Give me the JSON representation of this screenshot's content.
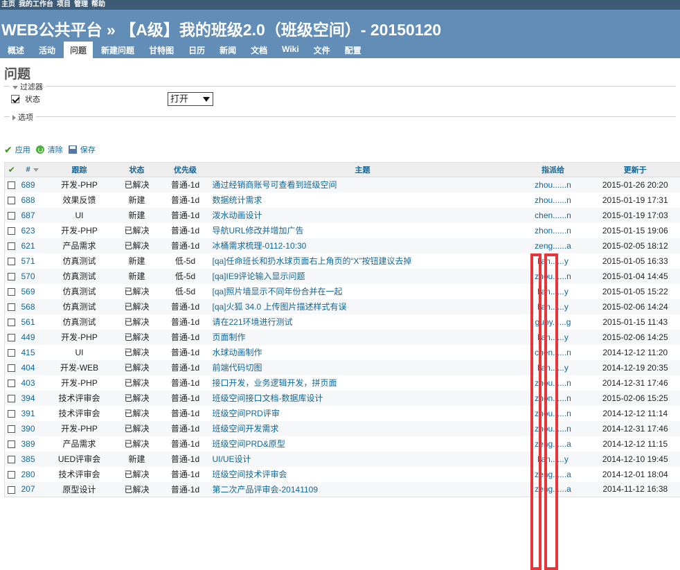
{
  "top_menu": [
    "主页",
    "我的工作台",
    "项目",
    "管理",
    "帮助"
  ],
  "header": {
    "title": "WEB公共平台 » 【A级】我的班级2.0（班级空间）- 20150120"
  },
  "tabs": [
    "概述",
    "活动",
    "问题",
    "新建问题",
    "甘特图",
    "日历",
    "新闻",
    "文档",
    "Wiki",
    "文件",
    "配置"
  ],
  "selected_tab": "问题",
  "page_title": "问题",
  "filters": {
    "legend": "过滤器",
    "status_label": "状态",
    "status_checked": true,
    "status_value": "打开"
  },
  "options_legend": "选项",
  "actions": {
    "apply": "应用",
    "clear": "清除",
    "save": "保存"
  },
  "table": {
    "headers": [
      "#",
      "跟踪",
      "状态",
      "优先级",
      "主题",
      "指派给",
      "更新于"
    ],
    "rows": [
      {
        "id": "689",
        "tracker": "开发-PHP",
        "status": "已解决",
        "priority": "普通-1d",
        "subject": "通过经销商账号可查看到班级空间",
        "assignee": "zhou......n",
        "updated": "2015-01-26 20:20"
      },
      {
        "id": "688",
        "tracker": "效果反馈",
        "status": "新建",
        "priority": "普通-1d",
        "subject": "数据统计需求",
        "assignee": "zhou......n",
        "updated": "2015-01-19 17:31"
      },
      {
        "id": "687",
        "tracker": "UI",
        "status": "新建",
        "priority": "普通-1d",
        "subject": "泼水动画设计",
        "assignee": "chen......n",
        "updated": "2015-01-19 17:03"
      },
      {
        "id": "623",
        "tracker": "开发-PHP",
        "status": "已解决",
        "priority": "普通-1d",
        "subject": "导航URL修改并增加广告",
        "assignee": "zhon......n",
        "updated": "2015-01-15 19:06"
      },
      {
        "id": "621",
        "tracker": "产品需求",
        "status": "已解决",
        "priority": "普通-1d",
        "subject": "冰桶需求梳理-0112-10:30",
        "assignee": "zeng......a",
        "updated": "2015-02-05 18:12"
      },
      {
        "id": "571",
        "tracker": "仿真测试",
        "status": "新建",
        "priority": "低-5d",
        "subject": "[qa]任命班长和扔水球页面右上角页的“X”按钮建议去掉",
        "assignee": "lian......y",
        "updated": "2015-01-05 16:33"
      },
      {
        "id": "570",
        "tracker": "仿真测试",
        "status": "新建",
        "priority": "低-5d",
        "subject": "[qa]IE9评论输入显示问题",
        "assignee": "zhou......n",
        "updated": "2015-01-04 14:45"
      },
      {
        "id": "569",
        "tracker": "仿真测试",
        "status": "已解决",
        "priority": "低-5d",
        "subject": "[qa]照片墙显示不同年份合并在一起",
        "assignee": "lian......y",
        "updated": "2015-01-05 15:22"
      },
      {
        "id": "568",
        "tracker": "仿真测试",
        "status": "已解决",
        "priority": "普通-1d",
        "subject": "[qa]火狐 34.0 上传图片描述样式有误",
        "assignee": "lian......y",
        "updated": "2015-02-06 14:24"
      },
      {
        "id": "561",
        "tracker": "仿真测试",
        "status": "已解决",
        "priority": "普通-1d",
        "subject": "请在221环境进行测试",
        "assignee": "guoy......g",
        "updated": "2015-01-15 11:43"
      },
      {
        "id": "449",
        "tracker": "开发-PHP",
        "status": "已解决",
        "priority": "普通-1d",
        "subject": "页面制作",
        "assignee": "lian......y",
        "updated": "2015-02-06 14:25"
      },
      {
        "id": "415",
        "tracker": "UI",
        "status": "已解决",
        "priority": "普通-1d",
        "subject": "水球动画制作",
        "assignee": "chen......n",
        "updated": "2014-12-12 11:20"
      },
      {
        "id": "404",
        "tracker": "开发-WEB",
        "status": "已解决",
        "priority": "普通-1d",
        "subject": "前端代码切图",
        "assignee": "lian......y",
        "updated": "2014-12-19 20:35"
      },
      {
        "id": "403",
        "tracker": "开发-PHP",
        "status": "已解决",
        "priority": "普通-1d",
        "subject": "接口开发，业务逻辑开发，拼页面",
        "assignee": "zhou......n",
        "updated": "2014-12-31 17:46"
      },
      {
        "id": "394",
        "tracker": "技术评审会",
        "status": "已解决",
        "priority": "普通-1d",
        "subject": "班级空间接口文档-数据库设计",
        "assignee": "zhon......n",
        "updated": "2015-02-06 15:25"
      },
      {
        "id": "391",
        "tracker": "技术评审会",
        "status": "已解决",
        "priority": "普通-1d",
        "subject": "班级空间PRD评审",
        "assignee": "zhou......n",
        "updated": "2014-12-12 11:14"
      },
      {
        "id": "390",
        "tracker": "开发-PHP",
        "status": "已解决",
        "priority": "普通-1d",
        "subject": "班级空间开发需求",
        "assignee": "zhou......n",
        "updated": "2014-12-31 17:46"
      },
      {
        "id": "389",
        "tracker": "产品需求",
        "status": "已解决",
        "priority": "普通-1d",
        "subject": "班级空间PRD&原型",
        "assignee": "zeng......a",
        "updated": "2014-12-12 11:15"
      },
      {
        "id": "385",
        "tracker": "UED评审会",
        "status": "新建",
        "priority": "普通-1d",
        "subject": "UI/UE设计",
        "assignee": "lian......y",
        "updated": "2014-12-10 19:45"
      },
      {
        "id": "280",
        "tracker": "技术评审会",
        "status": "已解决",
        "priority": "普通-1d",
        "subject": "班级空间技术评审会",
        "assignee": "zeng......a",
        "updated": "2014-12-01 18:04"
      },
      {
        "id": "207",
        "tracker": "原型设计",
        "status": "已解决",
        "priority": "普通-1d",
        "subject": "第二次产品评审会-20141109",
        "assignee": "zeng......a",
        "updated": "2014-11-12 16:38"
      }
    ]
  },
  "colors": {
    "header_bg": "#628db6",
    "top_menu_bg": "#3e5b76",
    "link": "#169",
    "redaction": "#e8353a"
  }
}
